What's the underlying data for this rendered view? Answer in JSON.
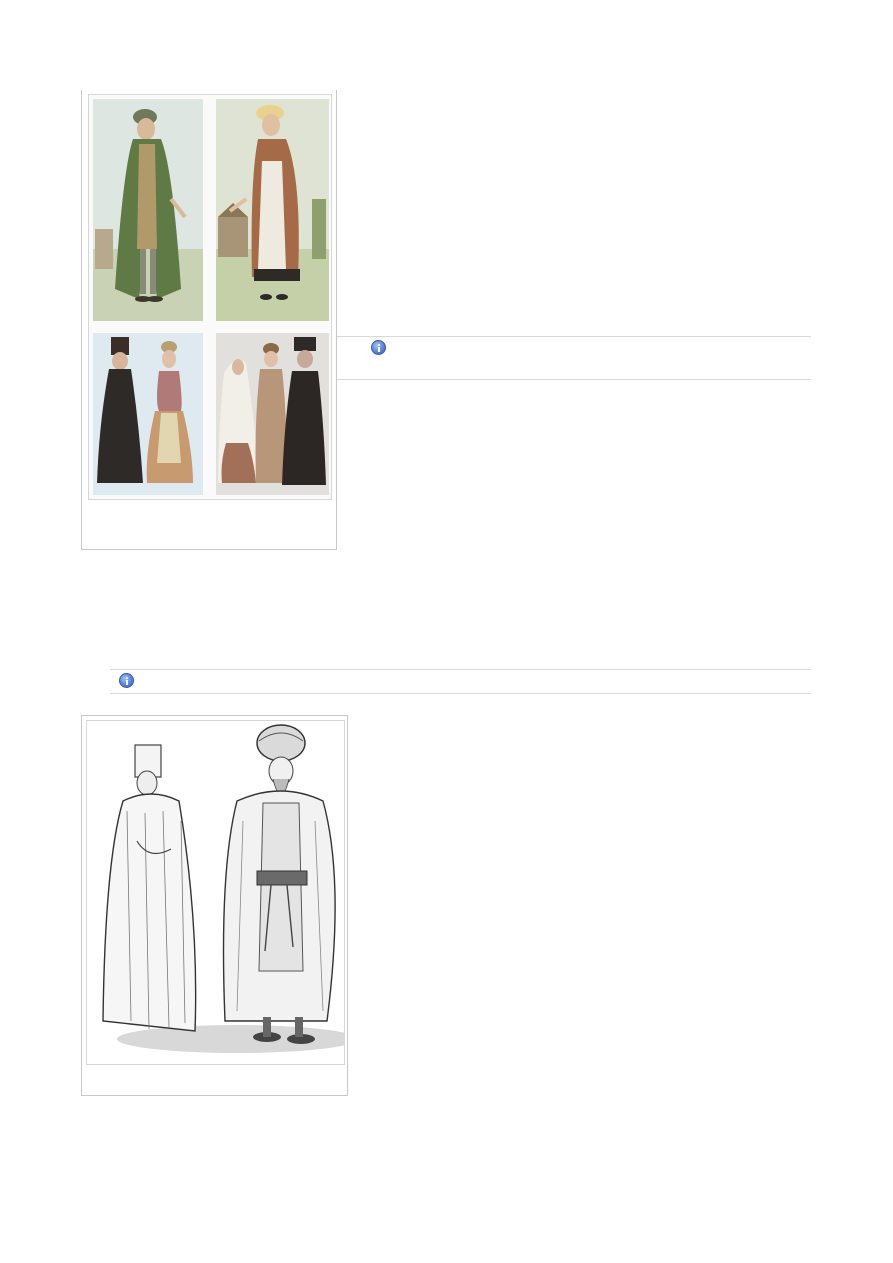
{
  "figures": [
    {
      "id": "figure-1",
      "caption": "",
      "panels": [
        {
          "name": "panel-man-green-coat",
          "subject": "man-in-green-coat-illustration"
        },
        {
          "name": "panel-woman-brown-coat",
          "subject": "woman-in-brown-coat-illustration"
        },
        {
          "name": "panel-couple",
          "subject": "couple-illustration"
        },
        {
          "name": "panel-group-three",
          "subject": "group-of-three-illustration"
        }
      ]
    },
    {
      "id": "figure-2",
      "caption": "",
      "panels": [
        {
          "name": "panel-two-figures-engraving",
          "subject": "two-figures-engraving"
        }
      ]
    }
  ],
  "info_bars": [
    {
      "icon": "info-icon",
      "text": ""
    },
    {
      "icon": "info-icon",
      "text": ""
    }
  ],
  "colors": {
    "border": "#c8c8c8",
    "info_icon": "#5b83d6"
  }
}
